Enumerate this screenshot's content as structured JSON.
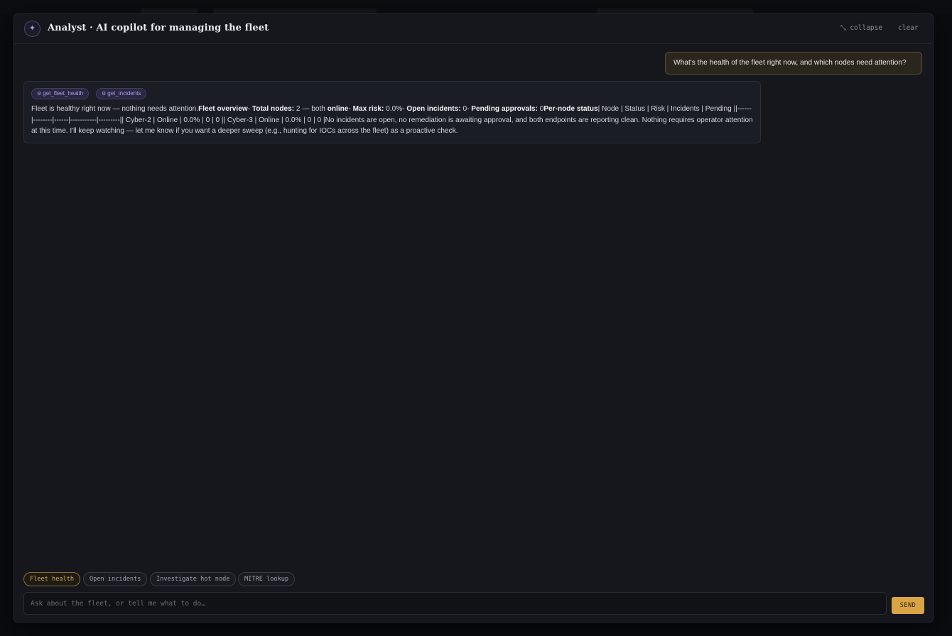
{
  "header": {
    "logo_glyph": "✦",
    "title": "Analyst · AI copilot for managing the fleet",
    "collapse_label": "⤡ collapse",
    "clear_label": "clear"
  },
  "conversation": {
    "user_message": "What's the health of the fleet right now, and which nodes need attention?",
    "assistant": {
      "tool_calls": [
        {
          "icon": "gear-icon",
          "glyph": "⚙",
          "label": "get_fleet_health"
        },
        {
          "icon": "gear-icon",
          "glyph": "⚙",
          "label": "get_incidents"
        }
      ],
      "segments": [
        {
          "text": "Fleet is healthy right now — nothing needs attention.",
          "bold": false
        },
        {
          "text": "Fleet overview",
          "bold": true
        },
        {
          "text": "- ",
          "bold": false
        },
        {
          "text": "Total nodes:",
          "bold": true
        },
        {
          "text": " 2 — both ",
          "bold": false
        },
        {
          "text": "online",
          "bold": true
        },
        {
          "text": "- ",
          "bold": false
        },
        {
          "text": "Max risk:",
          "bold": true
        },
        {
          "text": " 0.0%- ",
          "bold": false
        },
        {
          "text": "Open incidents:",
          "bold": true
        },
        {
          "text": " 0- ",
          "bold": false
        },
        {
          "text": "Pending approvals:",
          "bold": true
        },
        {
          "text": " 0",
          "bold": false
        },
        {
          "text": "Per-node status",
          "bold": true
        },
        {
          "text": "| Node | Status | Risk | Incidents | Pending ||------|--------|------|-----------|---------|| Cyber-2 | Online | 0.0% | 0 | 0 || Cyber-3 | Online | 0.0% | 0 | 0 |No incidents are open, no remediation is awaiting approval, and both endpoints are reporting clean. Nothing requires operator attention at this time. I'll keep watching — let me know if you want a deeper sweep (e.g., hunting for IOCs across the fleet) as a proactive check.",
          "bold": false
        }
      ]
    }
  },
  "suggestions": [
    {
      "label": "Fleet health",
      "active": true
    },
    {
      "label": "Open incidents",
      "active": false
    },
    {
      "label": "Investigate hot node",
      "active": false
    },
    {
      "label": "MITRE lookup",
      "active": false
    }
  ],
  "composer": {
    "placeholder": "Ask about the fleet, or tell me what to do…",
    "value": "",
    "send_label": "SEND"
  },
  "colors": {
    "accent": "#d9a444",
    "tool_chip": "#a99cf0",
    "panel_bg": "#15171d"
  }
}
